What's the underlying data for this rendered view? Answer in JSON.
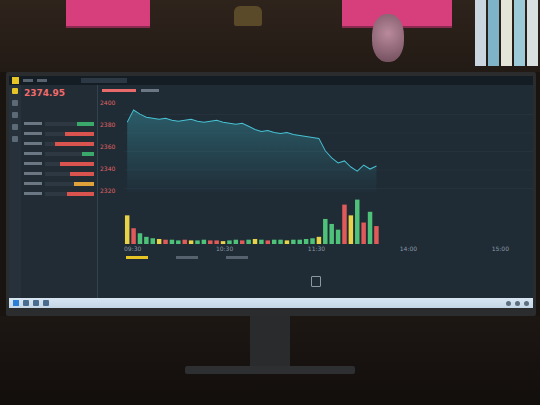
{
  "screen": {
    "app": {
      "price": "2374.95"
    },
    "side_rows": [
      {
        "color": "#3aa86b",
        "level": 0.35
      },
      {
        "color": "#d9534f",
        "level": 0.6
      },
      {
        "color": "#d9534f",
        "level": 0.8
      },
      {
        "color": "#3aa86b",
        "level": 0.25
      },
      {
        "color": "#d9534f",
        "level": 0.7
      },
      {
        "color": "#d9534f",
        "level": 0.5
      },
      {
        "color": "#e0a23a",
        "level": 0.4
      },
      {
        "color": "#d9534f",
        "level": 0.55
      }
    ],
    "chart": {
      "y_ticks": [
        "2400",
        "2380",
        "2360",
        "2340",
        "2320"
      ],
      "x_ticks": [
        "09:30",
        "10:30",
        "11:30",
        "14:00",
        "15:00"
      ],
      "price": [
        2380,
        2392,
        2388,
        2385,
        2384,
        2383,
        2384,
        2382,
        2381,
        2382,
        2383,
        2381,
        2380,
        2381,
        2382,
        2380,
        2379,
        2378,
        2379,
        2376,
        2373,
        2371,
        2372,
        2370,
        2369,
        2370,
        2368,
        2367,
        2366,
        2365,
        2364,
        2352,
        2345,
        2340,
        2342,
        2336,
        2332,
        2338,
        2334,
        2337
      ],
      "volume": [
        40,
        22,
        15,
        10,
        8,
        7,
        6,
        6,
        5,
        6,
        5,
        5,
        6,
        5,
        5,
        4,
        5,
        6,
        5,
        6,
        7,
        6,
        5,
        6,
        6,
        5,
        6,
        6,
        7,
        8,
        10,
        35,
        28,
        20,
        55,
        40,
        62,
        30,
        45,
        25
      ]
    }
  }
}
